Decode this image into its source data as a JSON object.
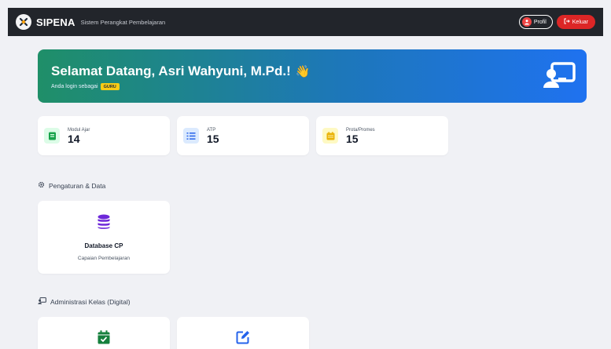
{
  "navbar": {
    "brand_title": "SIPENA",
    "brand_subtitle": "Sistem Perangkat Pembelajaran",
    "profile_label": "Profil",
    "logout_label": "Keluar"
  },
  "hero": {
    "greeting": "Selamat Datang, Asri Wahyuni, M.Pd.!",
    "emoji": "👋",
    "login_as": "Anda login sebagai",
    "role": "GURU"
  },
  "stats": [
    {
      "label": "Modul Ajar",
      "value": "14",
      "icon": "book-icon",
      "color": "#16a34a"
    },
    {
      "label": "ATP",
      "value": "15",
      "icon": "list-ol-icon",
      "color": "#2563eb"
    },
    {
      "label": "Prota/Promes",
      "value": "15",
      "icon": "calendar-icon",
      "color": "#eab308"
    }
  ],
  "sections": {
    "settings_title": "Pengaturan & Data",
    "admin_title": "Administrasi Kelas (Digital)"
  },
  "features": {
    "database": {
      "title": "Database CP",
      "subtitle": "Capaian Pembelajaran",
      "icon": "database-icon",
      "color": "#6d28d9"
    },
    "attendance": {
      "icon": "calendar-check-icon",
      "color": "#15803d"
    },
    "journal": {
      "icon": "edit-icon",
      "color": "#2563eb"
    }
  },
  "colors": {
    "navbar": "#22252b",
    "danger": "#dc2626",
    "hero_start": "#1f8f68",
    "hero_end": "#1f72f0"
  }
}
